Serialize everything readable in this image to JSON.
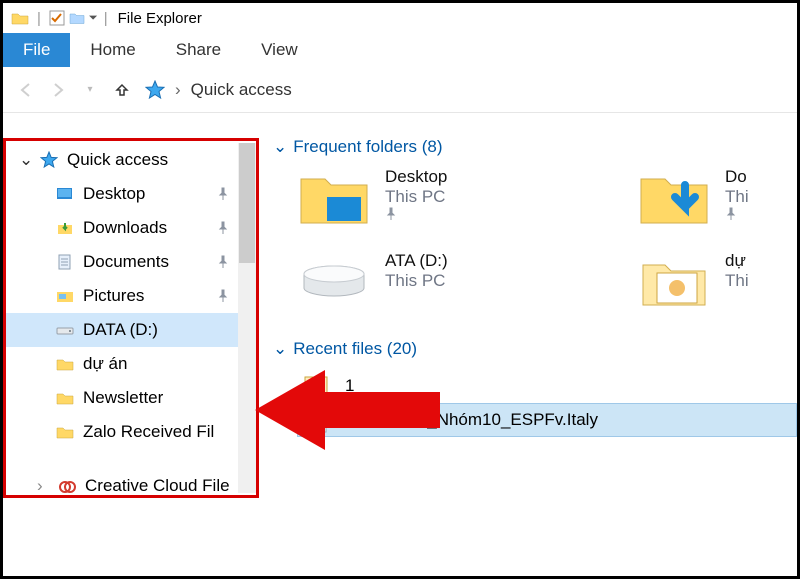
{
  "titlebar": {
    "app_title": "File Explorer"
  },
  "ribbon": {
    "file": "File",
    "tabs": [
      "Home",
      "Share",
      "View"
    ]
  },
  "breadcrumb": {
    "current": "Quick access"
  },
  "sidebar": {
    "root": "Quick access",
    "items": [
      {
        "label": "Desktop",
        "pinned": true
      },
      {
        "label": "Downloads",
        "pinned": true
      },
      {
        "label": "Documents",
        "pinned": true
      },
      {
        "label": "Pictures",
        "pinned": true
      },
      {
        "label": "DATA (D:)",
        "pinned": false
      },
      {
        "label": "dự án",
        "pinned": false
      },
      {
        "label": "Newsletter",
        "pinned": false
      },
      {
        "label": "Zalo Received Fil",
        "pinned": false
      }
    ],
    "other": "Creative Cloud File"
  },
  "content": {
    "frequent_header": "Frequent folders (8)",
    "recent_header": "Recent files (20)",
    "folders": [
      {
        "name": "Desktop",
        "location": "This PC",
        "pinned": true
      },
      {
        "name": "Do",
        "location": "Thi",
        "pinned": true
      },
      {
        "name": "ATA (D:)",
        "location": "This PC",
        "pinned": false
      },
      {
        "name": "dự",
        "location": "Thi",
        "pinned": false
      }
    ],
    "recent": [
      {
        "name": "1"
      },
      {
        "name": "TMQT43.1_Nhóm10_ESPFv.Italy"
      }
    ]
  }
}
